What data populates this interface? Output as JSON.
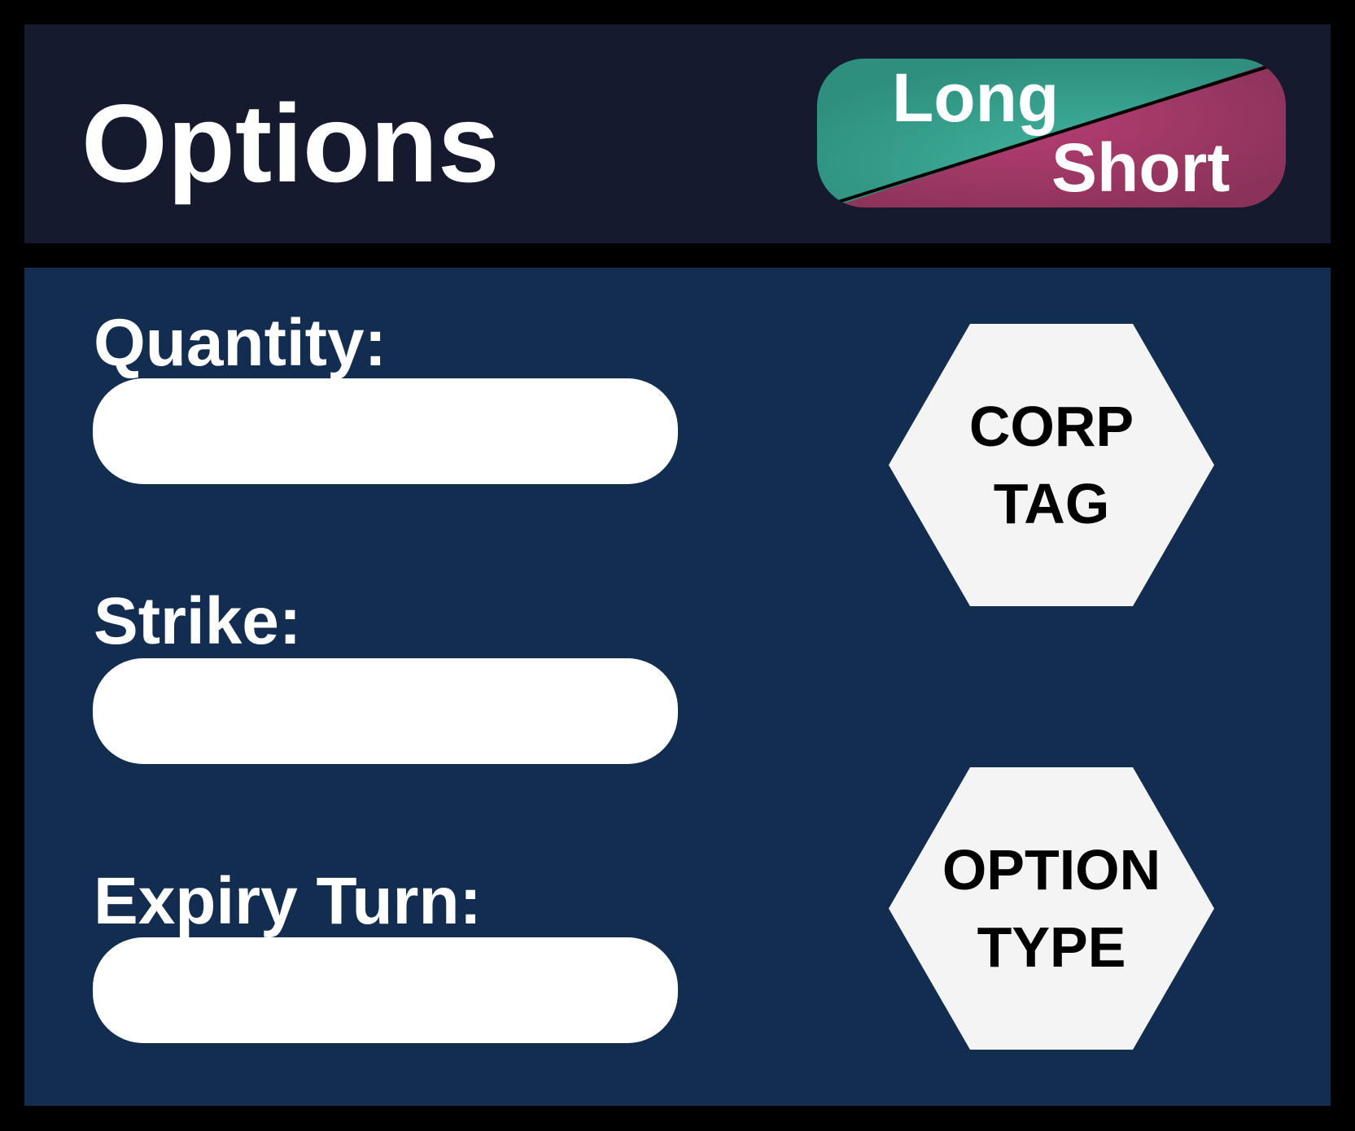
{
  "header": {
    "title": "Options"
  },
  "toggle": {
    "long_label": "Long",
    "short_label": "Short",
    "long_color": "#35a08d",
    "short_color": "#a23a6c"
  },
  "form": {
    "quantity": {
      "label": "Quantity:",
      "value": ""
    },
    "strike": {
      "label": "Strike:",
      "value": ""
    },
    "expiry": {
      "label": "Expiry Turn:",
      "value": ""
    }
  },
  "buttons": {
    "corp_tag": {
      "line1": "CORP",
      "line2": "TAG"
    },
    "option_type": {
      "line1": "OPTION",
      "line2": "TYPE"
    }
  }
}
